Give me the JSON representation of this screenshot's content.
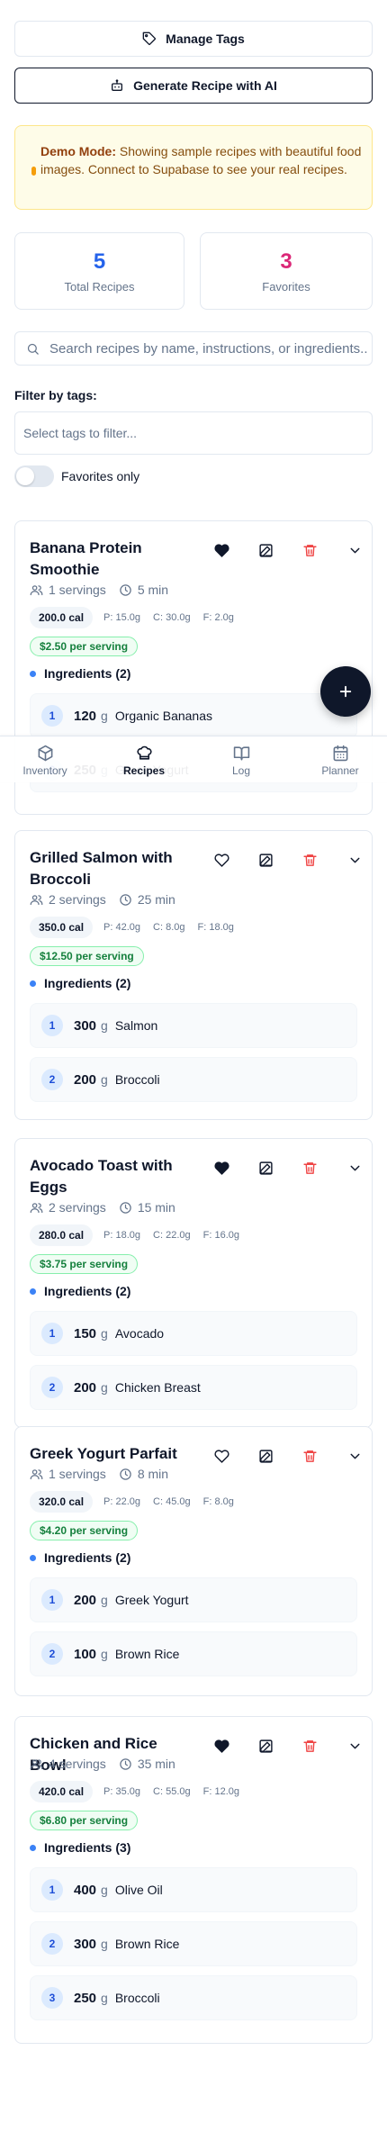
{
  "actions": {
    "manage_tags": "Manage Tags",
    "generate_ai": "Generate Recipe with AI"
  },
  "demo": {
    "label": "Demo Mode:",
    "message": "Showing sample recipes with beautiful food images. Connect to Supabase to see your real recipes."
  },
  "stats": {
    "total_value": "5",
    "total_label": "Total Recipes",
    "fav_value": "3",
    "fav_label": "Favorites"
  },
  "search": {
    "placeholder": "Search recipes by name, instructions, or ingredients..."
  },
  "filter": {
    "label": "Filter by tags:",
    "placeholder": "Select tags to filter...",
    "favorites_only": "Favorites only"
  },
  "recipes": [
    {
      "name": "Banana Protein Smoothie",
      "favorite": true,
      "servings": "1 servings",
      "time": "5 min",
      "calories": "200.0 cal",
      "protein": "P: 15.0g",
      "carbs": "C: 30.0g",
      "fat": "F: 2.0g",
      "price": "$2.50 per serving",
      "ingredients_label": "Ingredients (2)",
      "ingredients": [
        {
          "index": "1",
          "qty": "120",
          "unit": "g",
          "name": "Organic Bananas"
        },
        {
          "index": "2",
          "qty": "250",
          "unit": "g",
          "name": "Greek Yogurt"
        }
      ]
    },
    {
      "name": "Grilled Salmon with Broccoli",
      "favorite": false,
      "servings": "2 servings",
      "time": "25 min",
      "calories": "350.0 cal",
      "protein": "P: 42.0g",
      "carbs": "C: 8.0g",
      "fat": "F: 18.0g",
      "price": "$12.50 per serving",
      "ingredients_label": "Ingredients (2)",
      "ingredients": [
        {
          "index": "1",
          "qty": "300",
          "unit": "g",
          "name": "Salmon"
        },
        {
          "index": "2",
          "qty": "200",
          "unit": "g",
          "name": "Broccoli"
        }
      ]
    },
    {
      "name": "Avocado Toast with Eggs",
      "favorite": true,
      "servings": "2 servings",
      "time": "15 min",
      "calories": "280.0 cal",
      "protein": "P: 18.0g",
      "carbs": "C: 22.0g",
      "fat": "F: 16.0g",
      "price": "$3.75 per serving",
      "ingredients_label": "Ingredients (2)",
      "ingredients": [
        {
          "index": "1",
          "qty": "150",
          "unit": "g",
          "name": "Avocado"
        },
        {
          "index": "2",
          "qty": "200",
          "unit": "g",
          "name": "Chicken Breast"
        }
      ]
    },
    {
      "name": "Greek Yogurt Parfait",
      "favorite": false,
      "servings": "1 servings",
      "time": "8 min",
      "calories": "320.0 cal",
      "protein": "P: 22.0g",
      "carbs": "C: 45.0g",
      "fat": "F: 8.0g",
      "price": "$4.20 per serving",
      "ingredients_label": "Ingredients (2)",
      "ingredients": [
        {
          "index": "1",
          "qty": "200",
          "unit": "g",
          "name": "Greek Yogurt"
        },
        {
          "index": "2",
          "qty": "100",
          "unit": "g",
          "name": "Brown Rice"
        }
      ]
    },
    {
      "name": "Chicken and Rice Bowl",
      "favorite": true,
      "servings": "4 servings",
      "time": "35 min",
      "calories": "420.0 cal",
      "protein": "P: 35.0g",
      "carbs": "C: 55.0g",
      "fat": "F: 12.0g",
      "price": "$6.80 per serving",
      "ingredients_label": "Ingredients (3)",
      "ingredients": [
        {
          "index": "1",
          "qty": "400",
          "unit": "g",
          "name": "Olive Oil"
        },
        {
          "index": "2",
          "qty": "300",
          "unit": "g",
          "name": "Brown Rice"
        },
        {
          "index": "3",
          "qty": "250",
          "unit": "g",
          "name": "Broccoli"
        }
      ]
    }
  ],
  "nav": [
    {
      "label": "Inventory",
      "icon": "package-icon",
      "active": false
    },
    {
      "label": "Recipes",
      "icon": "chef-hat-icon",
      "active": true
    },
    {
      "label": "Log",
      "icon": "book-open-icon",
      "active": false
    },
    {
      "label": "Planner",
      "icon": "calendar-icon",
      "active": false
    }
  ],
  "colors": {
    "total_accent": "#2563eb",
    "favorites_accent": "#db2777",
    "delete_red": "#ef4444",
    "price_green": "#15803d"
  }
}
